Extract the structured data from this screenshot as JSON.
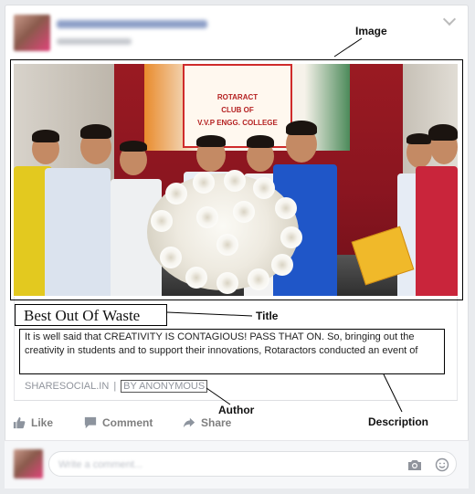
{
  "post": {
    "author_name": "",
    "timestamp": "",
    "link_preview": {
      "title": "Best Out Of Waste",
      "description": "It is well said that CREATIVITY IS CONTAGIOUS! PASS THAT ON. So, bringing out the creativity in students and to support their innovations, Rotaractors conducted an event of",
      "domain": "SHARESOCIAL.IN",
      "separator": "|",
      "author": "BY ANONYMOUS",
      "image_banner_line1": "ROTARACT",
      "image_banner_line2": "CLUB OF",
      "image_banner_line3": "V.V.P ENGG. COLLEGE"
    }
  },
  "annotations": {
    "image": "Image",
    "title": "Title",
    "author": "Author",
    "description": "Description"
  },
  "actions": {
    "like": "Like",
    "comment": "Comment",
    "share": "Share"
  },
  "comment_box": {
    "placeholder": "Write a comment..."
  },
  "icons": {
    "like": "thumbs-up-icon",
    "comment": "speech-bubble-icon",
    "share": "share-arrow-icon",
    "camera": "camera-icon",
    "emoji": "smiley-icon",
    "menu": "chevron-down-icon"
  },
  "colors": {
    "action_gray": "#7f7f7f",
    "meta_gray": "#90949c",
    "banner_red": "#cf2b2b"
  }
}
